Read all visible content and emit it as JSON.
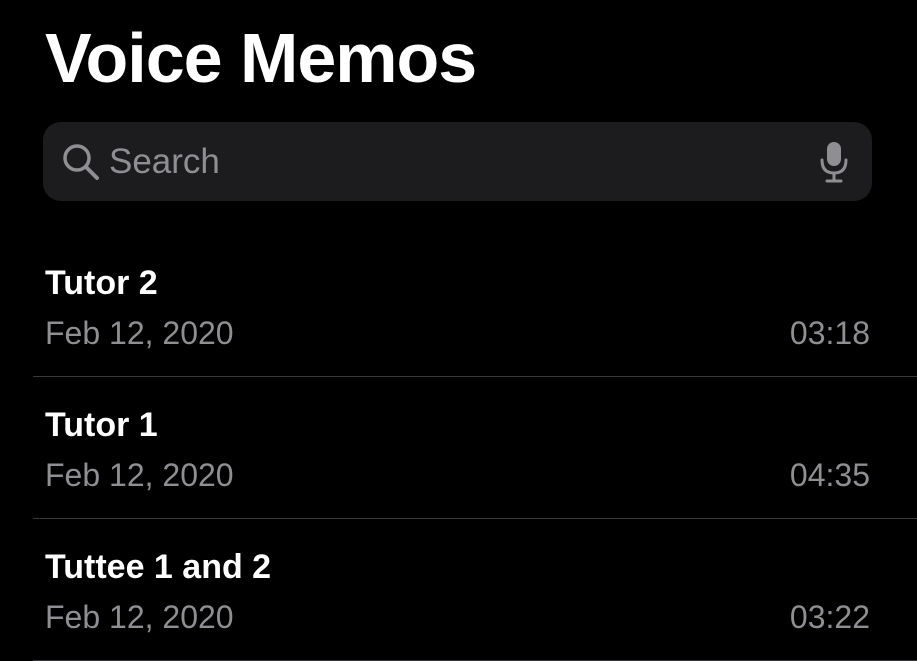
{
  "app": {
    "title": "Voice Memos"
  },
  "search": {
    "placeholder": "Search",
    "value": "",
    "icon": "magnifying-glass-icon",
    "dictation_icon": "microphone-icon"
  },
  "memos": [
    {
      "title": "Tutor 2",
      "date": "Feb 12, 2020",
      "duration": "03:18"
    },
    {
      "title": "Tutor 1",
      "date": "Feb 12, 2020",
      "duration": "04:35"
    },
    {
      "title": "Tuttee 1 and 2",
      "date": "Feb 12, 2020",
      "duration": "03:22"
    }
  ],
  "colors": {
    "background": "#000000",
    "search_field": "#1c1c1e",
    "primary_text": "#ffffff",
    "secondary_text": "#8e8e93",
    "separator": "#38383a"
  }
}
